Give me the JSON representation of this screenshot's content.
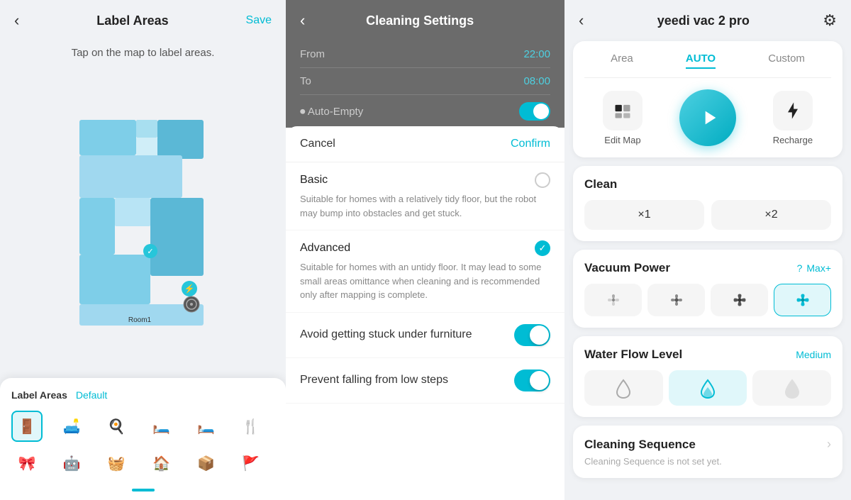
{
  "panel1": {
    "back_label": "‹",
    "title": "Label Areas",
    "save_label": "Save",
    "subtitle": "Tap on the map to label areas.",
    "bottom": {
      "label_areas": "Label Areas",
      "default": "Default",
      "room_label": "Room1"
    }
  },
  "panel2": {
    "back_label": "‹",
    "title": "Cleaning Settings",
    "from_label": "From",
    "from_value": "22:00",
    "to_label": "To",
    "to_value": "08:00",
    "auto_empty_label": "⏺ Auto-Empty",
    "cancel_label": "Cancel",
    "confirm_label": "Confirm",
    "basic": {
      "title": "Basic",
      "desc": "Suitable for homes with a relatively tidy floor, but the robot may bump into obstacles and get stuck."
    },
    "advanced": {
      "title": "Advanced",
      "desc": "Suitable for homes with an untidy floor. It may lead to some small areas omittance when cleaning and is recommended only after mapping is complete."
    },
    "toggle1": {
      "label": "Avoid getting stuck under furniture"
    },
    "toggle2": {
      "label": "Prevent falling from low steps"
    }
  },
  "panel3": {
    "back_label": "‹",
    "title": "yeedi vac 2 pro",
    "gear_label": "⚙",
    "tabs": [
      {
        "label": "Area",
        "active": false
      },
      {
        "label": "AUTO",
        "active": true
      },
      {
        "label": "Custom",
        "active": false
      }
    ],
    "edit_map": "Edit Map",
    "recharge": "Recharge",
    "clean_section": {
      "title": "Clean",
      "count1": "×1",
      "count2": "×2"
    },
    "vacuum_section": {
      "title": "Vacuum Power",
      "help": "?",
      "max_label": "Max+"
    },
    "water_section": {
      "title": "Water Flow Level",
      "level_label": "Medium"
    },
    "cleaning_seq": {
      "title": "Cleaning Sequence",
      "desc": "Cleaning Sequence is not set yet."
    }
  }
}
